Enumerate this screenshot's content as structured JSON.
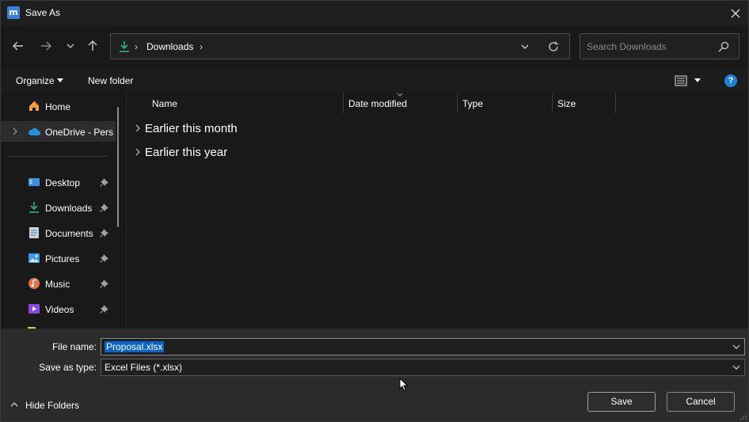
{
  "window": {
    "title": "Save As",
    "app_icon": "m",
    "close_icon": "close-icon"
  },
  "address": {
    "crumb": "Downloads",
    "icon": "download-icon"
  },
  "search": {
    "placeholder": "Search Downloads"
  },
  "toolbar": {
    "organize_label": "Organize",
    "new_folder_label": "New folder",
    "help_label": "?"
  },
  "nav": {
    "items": [
      {
        "label": "Home",
        "icon": "home-icon"
      },
      {
        "label": "OneDrive - Pers",
        "icon": "cloud-icon"
      },
      {
        "label": "Desktop",
        "icon": "desktop-icon",
        "pinned": true
      },
      {
        "label": "Downloads",
        "icon": "download-icon",
        "pinned": true
      },
      {
        "label": "Documents",
        "icon": "documents-icon",
        "pinned": true
      },
      {
        "label": "Pictures",
        "icon": "pictures-icon",
        "pinned": true
      },
      {
        "label": "Music",
        "icon": "music-icon",
        "pinned": true
      },
      {
        "label": "Videos",
        "icon": "videos-icon",
        "pinned": true
      }
    ]
  },
  "columns": {
    "name": "Name",
    "date_modified": "Date modified",
    "type": "Type",
    "size": "Size"
  },
  "groups": [
    {
      "label": "Earlier this month"
    },
    {
      "label": "Earlier this year"
    }
  ],
  "form": {
    "file_name_label": "File name:",
    "file_name_value": "Proposal.xlsx",
    "save_type_label": "Save as type:",
    "save_type_value": "Excel Files (*.xlsx)"
  },
  "footer": {
    "hide_folders_label": "Hide Folders",
    "save_label": "Save",
    "cancel_label": "Cancel"
  },
  "colors": {
    "accent": "#0a64c8",
    "background": "#191919",
    "panel": "#2b2b2b"
  }
}
